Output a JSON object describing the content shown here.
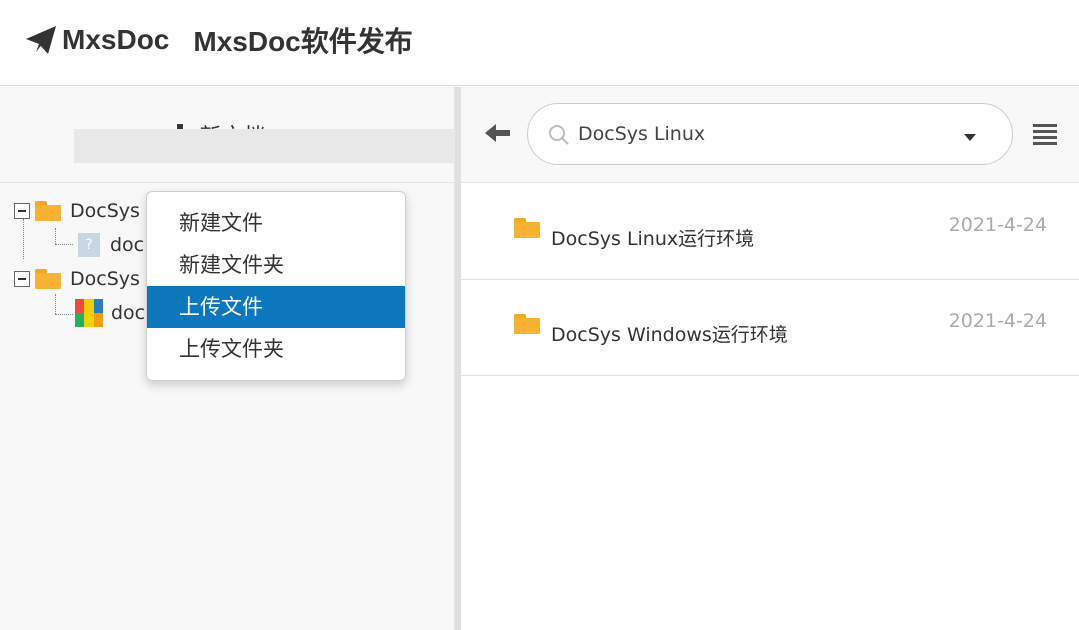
{
  "header": {
    "brand_name": "MxsDoc",
    "repo_name": "MxsDoc软件发布",
    "brand_icon": "paper-plane-icon"
  },
  "left_panel": {
    "new_doc_label": "新文档",
    "tree": [
      {
        "label": "DocSys",
        "type": "folder",
        "expanded": true
      },
      {
        "label": "doc",
        "type": "unknown-file"
      },
      {
        "label": "DocSys",
        "type": "folder",
        "expanded": true
      },
      {
        "label": "doc",
        "type": "zip-file"
      }
    ]
  },
  "dropdown_menu": {
    "items": [
      {
        "label": "新建文件"
      },
      {
        "label": "新建文件夹"
      },
      {
        "label": "上传文件",
        "active": true
      },
      {
        "label": "上传文件夹"
      }
    ]
  },
  "right_panel": {
    "search_value": "DocSys Linux",
    "files": [
      {
        "name": "DocSys Linux运行环境",
        "date": "2021-4-24",
        "icon": "folder-icon"
      },
      {
        "name": "DocSys Windows运行环境",
        "date": "2021-4-24",
        "icon": "folder-icon"
      }
    ]
  },
  "colors": {
    "accent": "#0c77bd",
    "folder": "#f7b234",
    "panel_bg": "#f8f8f8"
  }
}
